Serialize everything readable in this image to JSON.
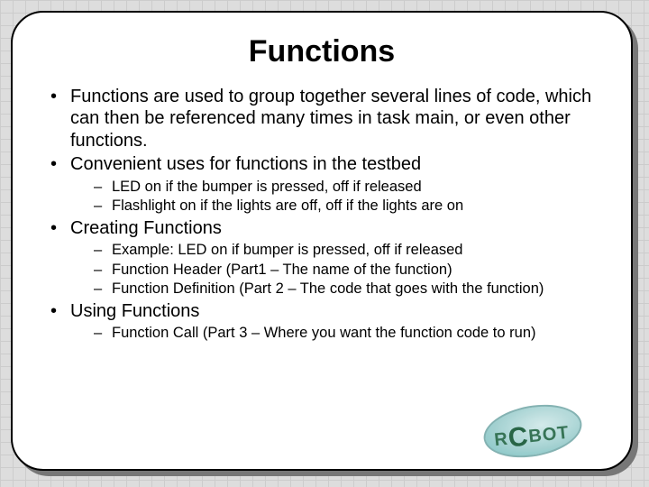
{
  "title": "Functions",
  "bullets": {
    "b0": "Functions are used to group together several lines of code, which can then be referenced many times in task main, or even other functions.",
    "b1": "Convenient uses for functions in the testbed",
    "b1_subs": {
      "s0": "LED on if the bumper is pressed, off if released",
      "s1": "Flashlight on if the lights are off, off if the lights are on"
    },
    "b2": "Creating Functions",
    "b2_subs": {
      "s0": "Example: LED on if bumper is pressed, off if released",
      "s1": "Function Header (Part1 – The name of the function)",
      "s2": "Function Definition (Part 2 – The code that goes with the function)"
    },
    "b3": "Using Functions",
    "b3_subs": {
      "s0": "Function Call (Part 3 – Where you want the function code to run)"
    }
  },
  "logo_text_parts": {
    "a": "R",
    "b": "C",
    "c": "BOT"
  }
}
